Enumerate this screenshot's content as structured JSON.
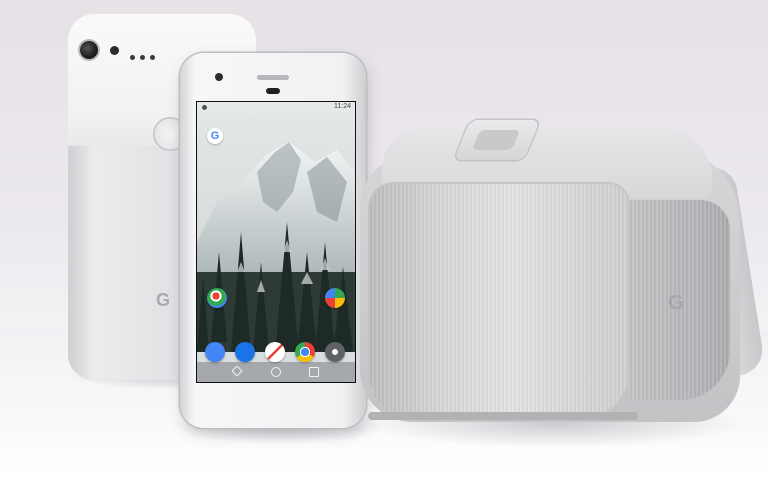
{
  "scene": {
    "description_items": [
      "rear-phone",
      "front-phone",
      "vr-headset"
    ]
  },
  "rear_phone": {
    "brand_mark": "G"
  },
  "front_phone": {
    "status_time": "11:24",
    "search_widget_letter": "G",
    "home_icons": [
      {
        "icon": "maps-icon",
        "color": "#34a853"
      },
      {
        "icon": "play-store-icon",
        "color": "#ea4335"
      },
      {
        "icon": "phone-icon",
        "color": "#4285f4"
      },
      {
        "icon": "messages-icon",
        "color": "#4285f4"
      },
      {
        "icon": "gmail-icon",
        "color": "#ffffff"
      },
      {
        "icon": "chrome-icon",
        "color": "#fbbc05"
      },
      {
        "icon": "camera-icon",
        "color": "#5f6368"
      }
    ]
  },
  "vr_headset": {
    "brand_mark": "G"
  }
}
